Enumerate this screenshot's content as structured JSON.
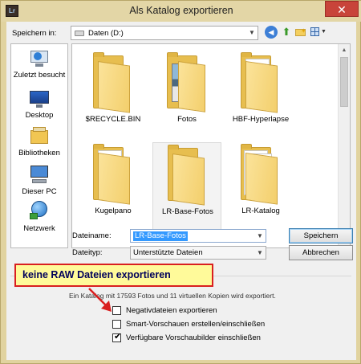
{
  "window": {
    "title": "Als Katalog exportieren",
    "app_icon_text": "Lr",
    "close_glyph": "✕"
  },
  "toolbar": {
    "savein_label": "Speichern in:",
    "location": "Daten (D:)",
    "icons": [
      "back-icon",
      "up-folder-icon",
      "new-folder-icon",
      "views-menu-icon"
    ]
  },
  "places": [
    {
      "label": "Zuletzt besucht",
      "icon": "recent-places-icon"
    },
    {
      "label": "Desktop",
      "icon": "desktop-icon"
    },
    {
      "label": "Bibliotheken",
      "icon": "libraries-icon"
    },
    {
      "label": "Dieser PC",
      "icon": "computer-icon"
    },
    {
      "label": "Netzwerk",
      "icon": "network-icon"
    }
  ],
  "files": [
    {
      "name": "$RECYCLE.BIN"
    },
    {
      "name": "Fotos"
    },
    {
      "name": "HBF-Hyperlapse"
    },
    {
      "name": "Kugelpano"
    },
    {
      "name": "LR-Base-Fotos"
    },
    {
      "name": "LR-Katalog"
    }
  ],
  "form": {
    "filename_label": "Dateiname:",
    "filename_value": "LR-Base-Fotos",
    "filetype_label": "Dateityp:",
    "filetype_value": "Unterstützte Dateien",
    "save_label": "Speichern",
    "cancel_label": "Abbrechen"
  },
  "options": {
    "info": "Ein Katalog mit 17593 Fotos und 11 virtuellen Kopien wird exportiert.",
    "checkboxes": [
      {
        "label": "Negativdateien exportieren",
        "checked": false
      },
      {
        "label": "Smart-Vorschauen erstellen/einschließen",
        "checked": false
      },
      {
        "label": "Verfügbare Vorschaubilder einschließen",
        "checked": true
      }
    ],
    "checkmark": "✔"
  },
  "annotation": {
    "text": "keine RAW Dateien exportieren",
    "border_color": "#d91f1f",
    "fill_color": "#fffa9a"
  }
}
